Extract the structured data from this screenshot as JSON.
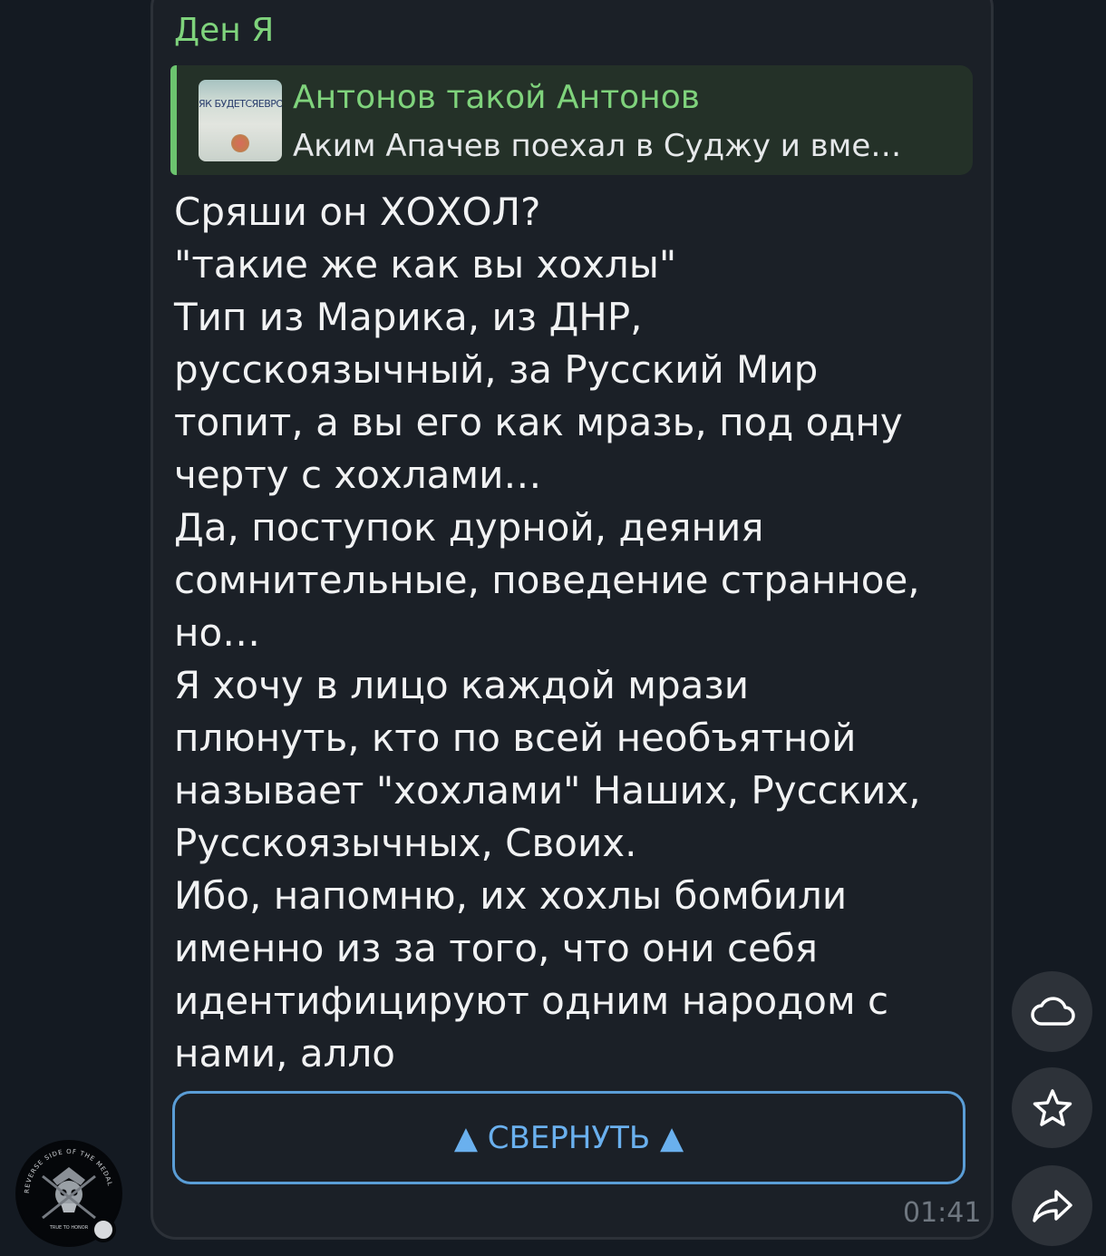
{
  "message": {
    "sender": "Ден Я",
    "reply": {
      "title": "Антонов такой Антонов",
      "preview": "Аким Апачев поехал в Суджу и вме…",
      "thumbnail_text": "ЯК БУДЕТСЯЕВРОП"
    },
    "lines": [
      "Сряши он ХОХОЛ?",
      "\"такие же как вы хохлы\"",
      "Тип из Марика, из ДНР,",
      "русскоязычный, за Русский Мир",
      "топит, а вы его как мразь, под одну",
      "черту с хохлами…",
      "Да, поступок дурной, деяния",
      "сомнительные, поведение странное,",
      "но…",
      "Я хочу в лицо каждой мрази",
      "плюнуть, кто по всей необъятной",
      "называет \"хохлами\" Наших, Русских,",
      "Русскоязычных, Своих.",
      "Ибо, напомню, их хохлы бомбили",
      "именно из за того, что они себя",
      "идентифицируют одним народом с",
      "нами, алло"
    ],
    "collapse_label": "▲ СВЕРНУТЬ ▲",
    "time": "01:41"
  },
  "avatar": {
    "ring_text": "REVERSE SIDE OF THE MEDAL",
    "bottom_text": "TRUE TO HONOR"
  },
  "side_actions": [
    {
      "icon": "cloud-icon"
    },
    {
      "icon": "star-icon"
    },
    {
      "icon": "share-icon"
    }
  ],
  "colors": {
    "background": "#141a22",
    "bubble": "#1b2027",
    "accent_green": "#7fd37c",
    "accent_blue": "#6ab0ee",
    "text": "#f1f2f3"
  }
}
